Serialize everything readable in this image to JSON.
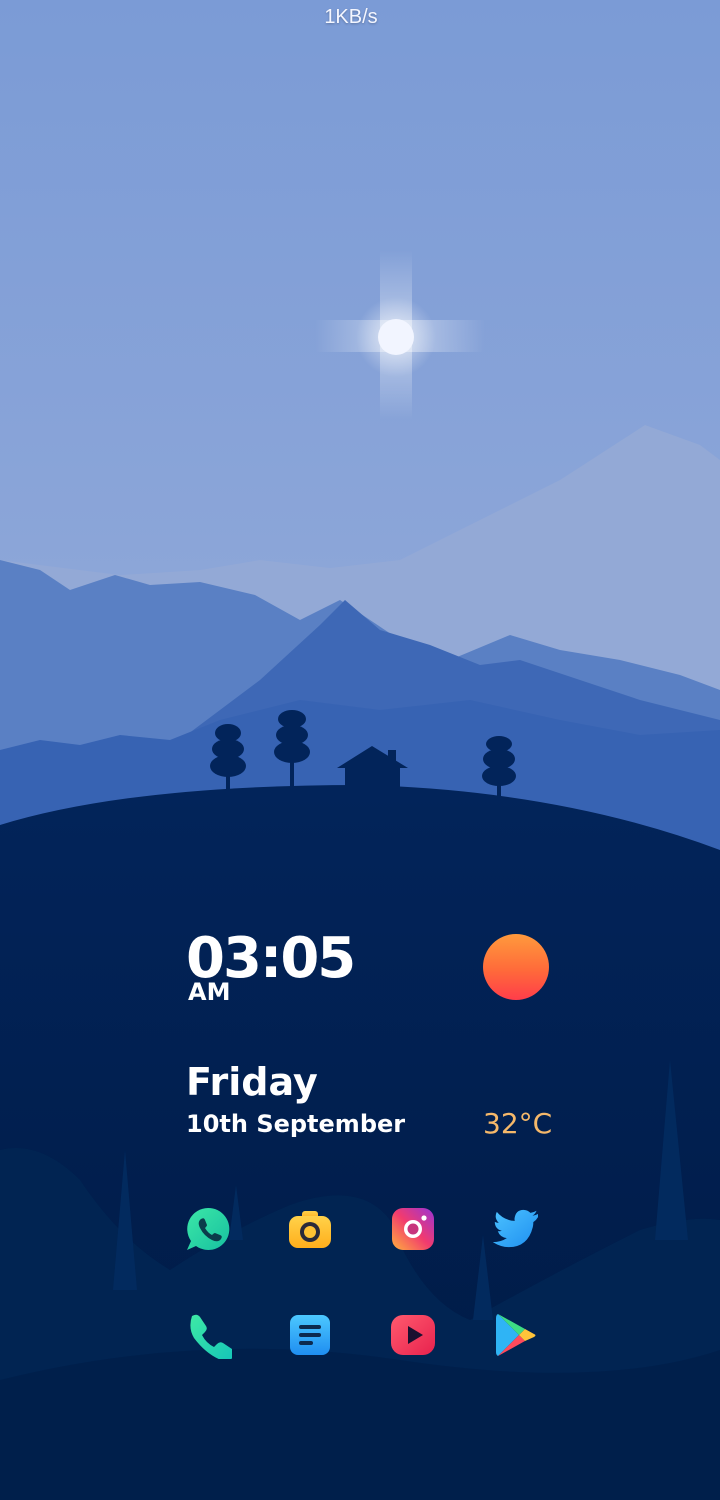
{
  "status_bar": {
    "network_speed": "1KB/s"
  },
  "widget": {
    "time": "03:05",
    "ampm": "AM",
    "day": "Friday",
    "date": "10th September",
    "temperature": "32°C",
    "weather_icon": "sun-icon"
  },
  "dock": {
    "row1": [
      "whatsapp-icon",
      "camera-icon",
      "instagram-icon",
      "twitter-icon"
    ],
    "row2": [
      "phone-icon",
      "notes-icon",
      "youtube-icon",
      "play-store-icon"
    ]
  },
  "colors": {
    "sky_top": "#7d9ed8",
    "sky_bottom": "#9fb3dc",
    "hill_dark": "#01204f",
    "temperature": "#f5b86a"
  }
}
